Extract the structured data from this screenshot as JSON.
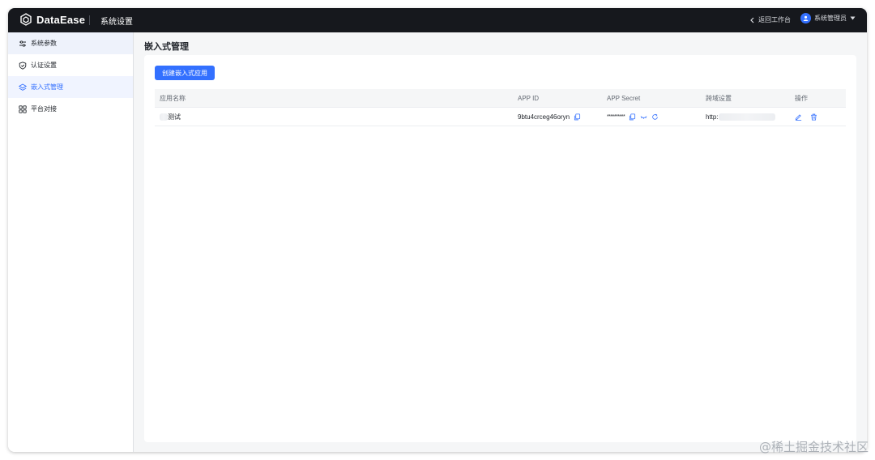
{
  "header": {
    "brand": "DataEase",
    "app_title": "系统设置",
    "back_label": "返回工作台",
    "user_name": "系统管理员"
  },
  "sidebar": {
    "items": [
      {
        "label": "系统参数",
        "icon": "sliders-icon",
        "state": "hover"
      },
      {
        "label": "认证设置",
        "icon": "shield-icon",
        "state": "normal"
      },
      {
        "label": "嵌入式管理",
        "icon": "layers-icon",
        "state": "active"
      },
      {
        "label": "平台对接",
        "icon": "grid-icon",
        "state": "normal"
      }
    ]
  },
  "main": {
    "title": "嵌入式管理",
    "create_button": "创建嵌入式应用",
    "table": {
      "columns": [
        "应用名称",
        "APP ID",
        "APP Secret",
        "跨域设置",
        "操作"
      ],
      "rows": [
        {
          "name": "测试",
          "app_id": "9btu4crceg46oryn",
          "app_secret": "**********",
          "cors": "http:"
        }
      ]
    }
  },
  "watermark": "@稀土掘金技术社区",
  "colors": {
    "accent": "#3370ff",
    "topbar": "#16181d",
    "text": "#1f2329"
  }
}
